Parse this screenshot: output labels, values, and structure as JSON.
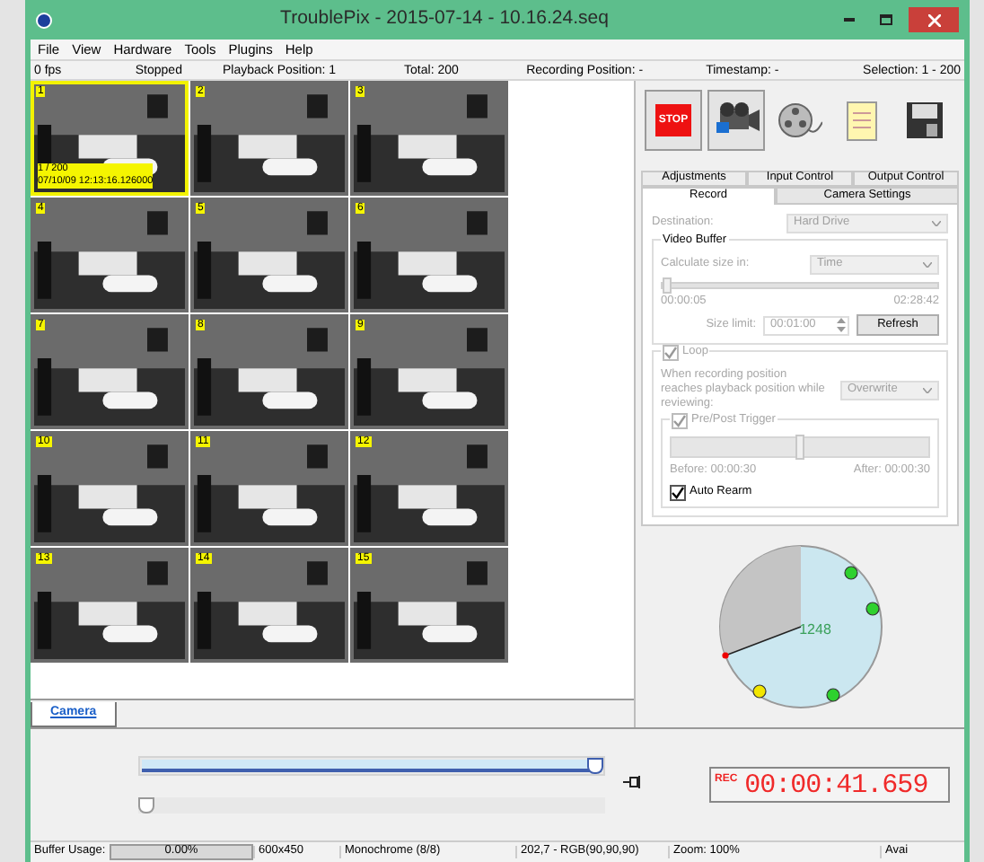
{
  "window": {
    "title": "TroublePix - 2015-07-14 - 10.16.24.seq"
  },
  "menu": [
    "File",
    "View",
    "Hardware",
    "Tools",
    "Plugins",
    "Help"
  ],
  "info_bar": [
    "0 fps",
    "Stopped",
    "Playback Position: 1",
    "Total: 200",
    "Recording Position: -",
    "Timestamp: -",
    "Selection: 1 - 200"
  ],
  "thumbnails": [
    {
      "number": "1",
      "selected": true,
      "overlay": [
        "1 / 200",
        "07/10/09 12:13:16.126000"
      ]
    },
    {
      "number": "2",
      "selected": false
    },
    {
      "number": "3",
      "selected": false
    },
    {
      "number": "4",
      "selected": false
    },
    {
      "number": "5",
      "selected": false
    },
    {
      "number": "6",
      "selected": false
    },
    {
      "number": "7",
      "selected": false
    },
    {
      "number": "8",
      "selected": false
    },
    {
      "number": "9",
      "selected": false
    },
    {
      "number": "10",
      "selected": false
    },
    {
      "number": "11",
      "selected": false
    },
    {
      "number": "12",
      "selected": false
    },
    {
      "number": "13",
      "selected": false
    },
    {
      "number": "14",
      "selected": false
    },
    {
      "number": "15",
      "selected": false
    }
  ],
  "left_tabs": [
    {
      "label": "Camera",
      "selected": true
    }
  ],
  "toolbar": [
    {
      "kind": "stop",
      "label": "STOP",
      "pressed": true
    },
    {
      "kind": "camera",
      "pressed": true
    },
    {
      "kind": "reel",
      "pressed": false
    },
    {
      "kind": "notepad",
      "pressed": false
    },
    {
      "kind": "floppy",
      "pressed": false
    }
  ],
  "tabs_back": [
    {
      "label": "Adjustments",
      "selected": false
    },
    {
      "label": "Input Control",
      "selected": false
    },
    {
      "label": "Output Control",
      "selected": false
    }
  ],
  "tabs_front": [
    {
      "label": "Record",
      "selected": true
    },
    {
      "label": "Camera Settings",
      "selected": false
    }
  ],
  "record": {
    "destination": {
      "label": "Destination:",
      "value": "Hard Drive",
      "disabled": true
    },
    "video_buffer": {
      "title": "Video Buffer",
      "calc_label": "Calculate size in:",
      "calc_value": "Time",
      "level": 0.0,
      "min": "00:00:05",
      "max": "02:28:42",
      "size_label": "Size limit:",
      "size_value": "00:01:00",
      "refresh": "Refresh",
      "disabled": true
    },
    "loop": {
      "label": "Loop",
      "checked": true,
      "disabled": true,
      "text": "When recording position reaches playback position while reviewing:",
      "mode": "Overwrite"
    },
    "trigger": {
      "label": "Pre/Post Trigger",
      "checked": true,
      "disabled": true,
      "level": 0.5,
      "before": "Before: 00:00:30",
      "after": "After: 00:00:30"
    },
    "auto_rearm": {
      "label": "Auto Rearm",
      "checked": true,
      "disabled": false
    }
  },
  "buffer_dial": {
    "count": "1248"
  },
  "playback": {
    "position": {
      "level": 1.0
    },
    "speed": {
      "level": 0.0
    }
  },
  "rec_display": {
    "label": "REC",
    "time": "00:00:41.659"
  },
  "status_bar": {
    "buffer": {
      "label": "Buffer Usage:",
      "value": "0.00%",
      "level": 0.0
    },
    "fields": [
      "600x450",
      "Monochrome (8/8)",
      "202,7 - RGB(90,90,90)",
      "Zoom: 100%",
      "Avai"
    ]
  }
}
